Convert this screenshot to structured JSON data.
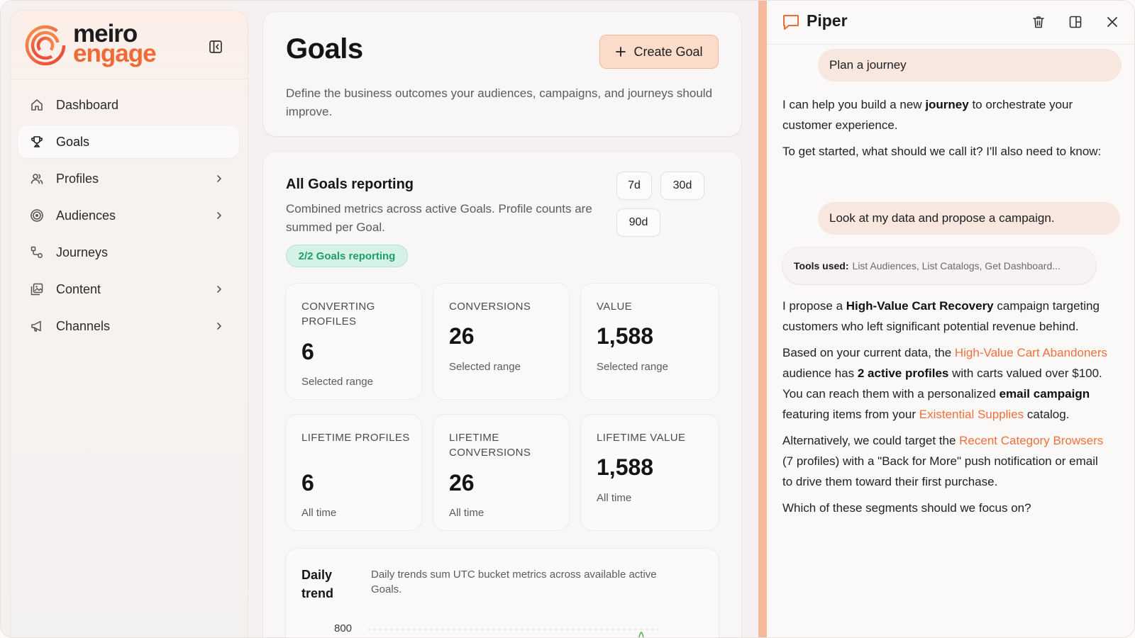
{
  "brand": {
    "word1": "meiro",
    "word2": "engage"
  },
  "nav": [
    {
      "label": "Dashboard",
      "icon": "home-icon",
      "active": false,
      "chevron": false
    },
    {
      "label": "Goals",
      "icon": "trophy-icon",
      "active": true,
      "chevron": false
    },
    {
      "label": "Profiles",
      "icon": "users-icon",
      "active": false,
      "chevron": true
    },
    {
      "label": "Audiences",
      "icon": "target-icon",
      "active": false,
      "chevron": true
    },
    {
      "label": "Journeys",
      "icon": "route-icon",
      "active": false,
      "chevron": false
    },
    {
      "label": "Content",
      "icon": "images-icon",
      "active": false,
      "chevron": true
    },
    {
      "label": "Channels",
      "icon": "megaphone-icon",
      "active": false,
      "chevron": true
    }
  ],
  "header": {
    "title": "Goals",
    "description": "Define the business outcomes your audiences, campaigns, and journeys should improve.",
    "create_label": "Create Goal"
  },
  "report": {
    "title": "All Goals reporting",
    "description": "Combined metrics across active Goals. Profile counts are summed per Goal.",
    "ranges": [
      "7d",
      "30d",
      "90d"
    ],
    "badge": "2/2 Goals reporting",
    "metrics": [
      {
        "label": "CONVERTING PROFILES",
        "value": "6",
        "sub": "Selected range"
      },
      {
        "label": "CONVERSIONS",
        "value": "26",
        "sub": "Selected range"
      },
      {
        "label": "VALUE",
        "value": "1,588",
        "sub": "Selected range"
      },
      {
        "label": "LIFETIME PROFILES",
        "value": "6",
        "sub": "All time"
      },
      {
        "label": "LIFETIME CONVERSIONS",
        "value": "26",
        "sub": "All time"
      },
      {
        "label": "LIFETIME VALUE",
        "value": "1,588",
        "sub": "All time"
      }
    ],
    "trend": {
      "title": "Daily trend",
      "description": "Daily trends sum UTC bucket metrics across available active Goals.",
      "y_tick": "800"
    }
  },
  "piper": {
    "title": "Piper",
    "messages": {
      "user1": "Plan a journey",
      "a1_p1_pre": "I can help you build a new ",
      "a1_p1_bold": "journey",
      "a1_p1_post": " to orchestrate your customer experience.",
      "a1_p2": "To get started, what should we call it? I'll also need to know:",
      "user2": "Look at my data and propose a campaign.",
      "tools_label": "Tools used:",
      "tools_list": "List Audiences, List Catalogs, Get Dashboard...",
      "a2_p1_pre": "I propose a ",
      "a2_p1_bold": "High-Value Cart Recovery",
      "a2_p1_post": " campaign targeting customers who left significant potential revenue behind.",
      "a2_p2_pre": "Based on your current data, the ",
      "a2_p2_link1": "High-Value Cart Abandoners",
      "a2_p2_mid1": " audience has ",
      "a2_p2_bold1": "2 active profiles",
      "a2_p2_mid2": " with carts valued over $100. You can reach them with a personalized ",
      "a2_p2_bold2": "email campaign",
      "a2_p2_mid3": " featuring items from your ",
      "a2_p2_link2": "Existential Supplies",
      "a2_p2_post": " catalog.",
      "a2_p3_pre": "Alternatively, we could target the ",
      "a2_p3_link": "Recent Category Browsers",
      "a2_p3_post": " (7 profiles) with a \"Back for More\" push notification or email to drive them toward their first purchase.",
      "a2_p4": "Which of these segments should we focus on?"
    }
  },
  "colors": {
    "accent": "#f06a36",
    "badge_green": "#1e9e6c",
    "link": "#f0703a"
  }
}
